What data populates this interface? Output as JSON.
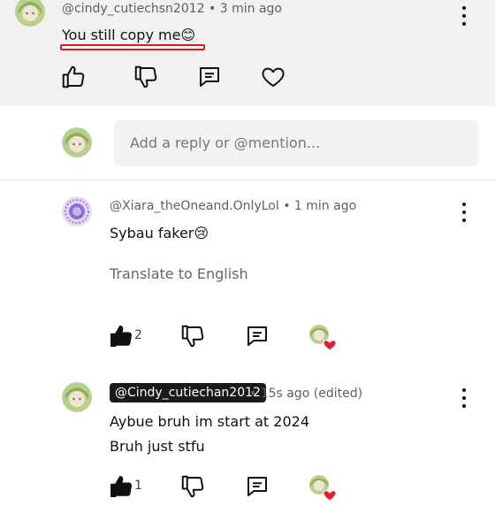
{
  "top_comment": {
    "handle": "@cindy_cutiechsn2012",
    "time": "3 min ago",
    "text": "You still copy me😊"
  },
  "reply_input": {
    "placeholder": "Add a reply or @mention..."
  },
  "replies": [
    {
      "handle": "@Xiara_theOneand.OnlyLol",
      "time": "1 min ago",
      "text": "Sybau faker😢",
      "translate": "Translate to English",
      "likes": "2"
    },
    {
      "mention": "@Cindy_cutiechan2012",
      "time": "15s ago (edited)",
      "line1": "Aybue bruh im start at 2024",
      "line2": "Bruh just stfu",
      "likes": "1"
    }
  ],
  "separator": "•",
  "colors": {
    "highlight_outline": "#d62020",
    "heart": "#e0202e"
  },
  "icons": [
    "thumbs-up-icon",
    "thumbs-down-icon",
    "reply-icon",
    "heart-icon",
    "more-vertical-icon"
  ]
}
